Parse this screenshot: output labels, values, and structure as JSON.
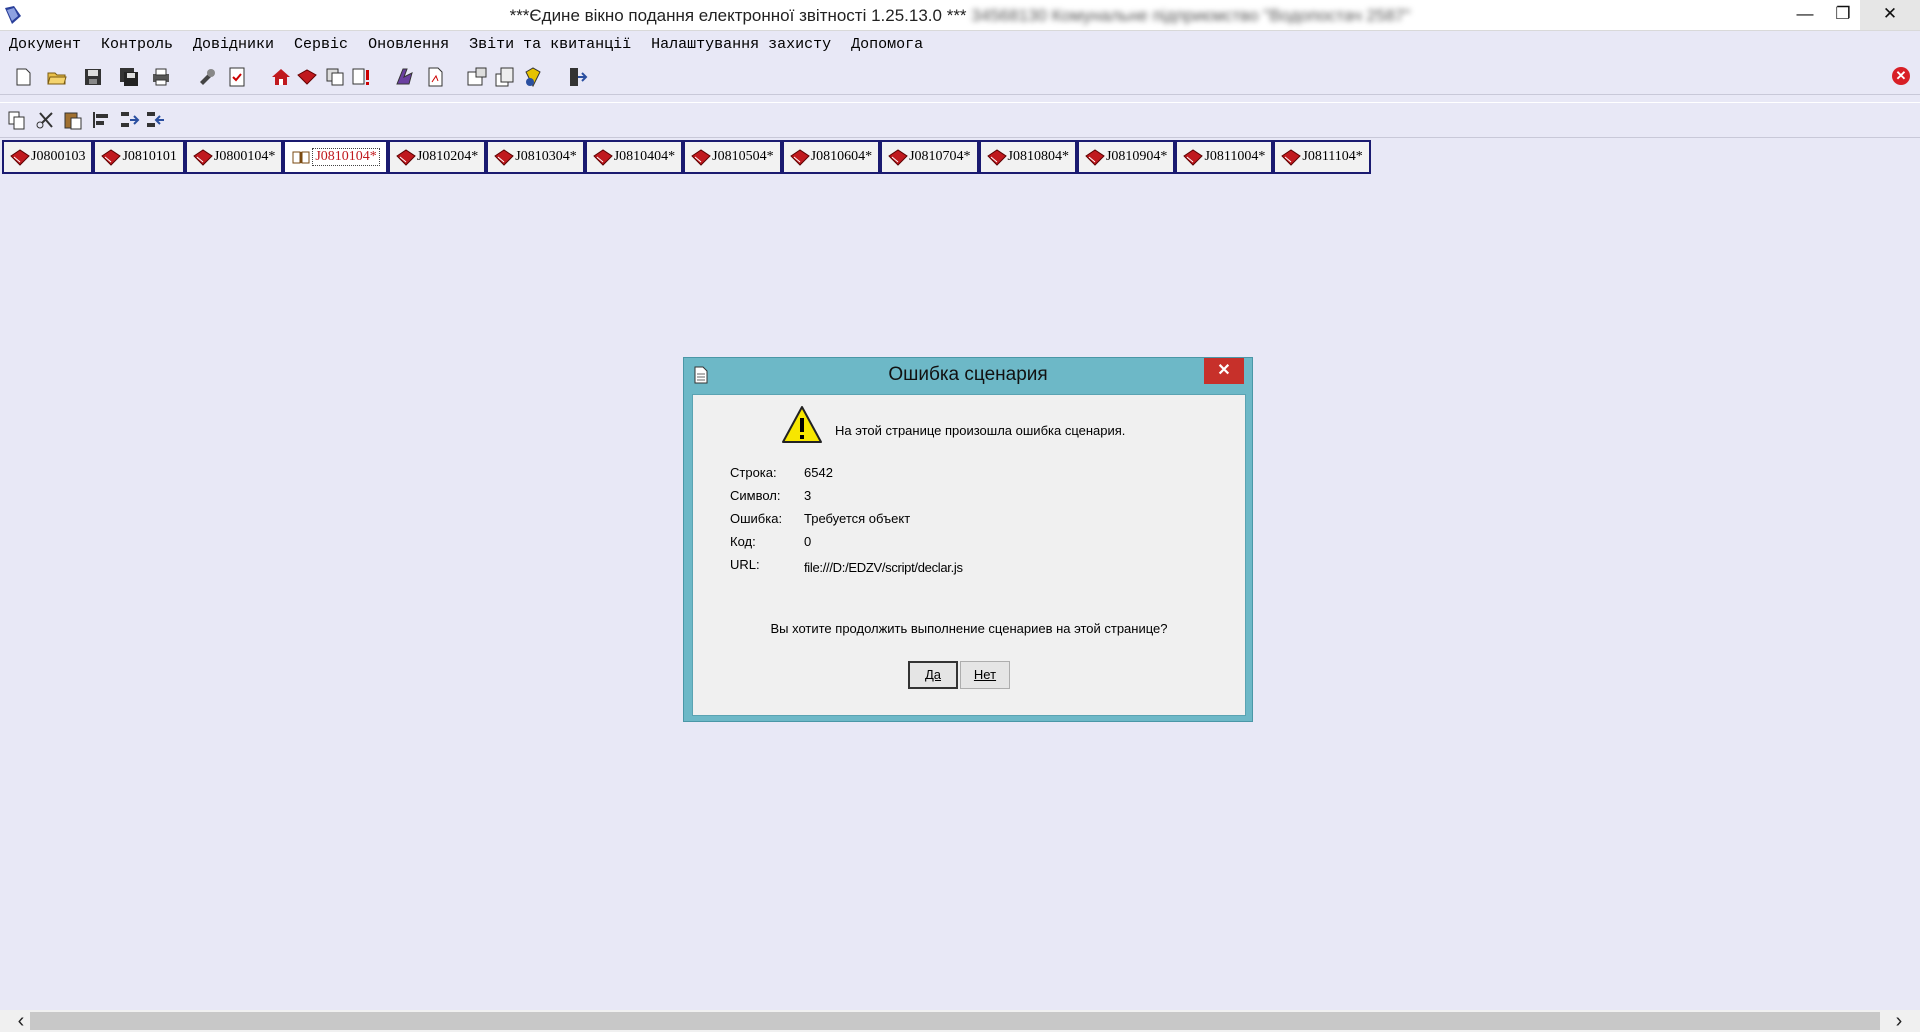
{
  "window": {
    "title": "***Єдине вікно подання електронної звітності 1.25.13.0 ***",
    "title_suffix": "34568130 Комунальне підприємство \"Водопостач 2587\"",
    "minimize": "—",
    "restore": "❐",
    "close": "✕"
  },
  "menu": [
    {
      "label": "Документ"
    },
    {
      "label": "Контроль"
    },
    {
      "label": "Довідники"
    },
    {
      "label": "Сервіс"
    },
    {
      "label": "Оновлення"
    },
    {
      "label": "Звіти та квитанції"
    },
    {
      "label": "Налаштування захисту"
    },
    {
      "label": "Допомога"
    }
  ],
  "toolbar_close": "✕",
  "tabs": [
    {
      "label": "J0800103",
      "active": false
    },
    {
      "label": "J0810101",
      "active": false
    },
    {
      "label": "J0800104*",
      "active": false
    },
    {
      "label": "J0810104*",
      "active": true
    },
    {
      "label": "J0810204*",
      "active": false
    },
    {
      "label": "J0810304*",
      "active": false
    },
    {
      "label": "J0810404*",
      "active": false
    },
    {
      "label": "J0810504*",
      "active": false
    },
    {
      "label": "J0810604*",
      "active": false
    },
    {
      "label": "J0810704*",
      "active": false
    },
    {
      "label": "J0810804*",
      "active": false
    },
    {
      "label": "J0810904*",
      "active": false
    },
    {
      "label": "J0811004*",
      "active": false
    },
    {
      "label": "J0811104*",
      "active": false
    }
  ],
  "dialog": {
    "title": "Ошибка сценария",
    "close": "✕",
    "message": "На этой странице произошла ошибка сценария.",
    "rows": [
      {
        "key": "Строка:",
        "value": "6542"
      },
      {
        "key": "Символ:",
        "value": "3"
      },
      {
        "key": "Ошибка:",
        "value": "Требуется объект"
      },
      {
        "key": "Код:",
        "value": "0"
      },
      {
        "key": "URL:",
        "value": "file:///D:/EDZV/script/declar.js"
      }
    ],
    "question": "Вы хотите продолжить выполнение сценариев на этой странице?",
    "yes": "Да",
    "no": "Нет"
  },
  "scroll": {
    "left": "‹",
    "right": "›"
  },
  "colors": {
    "background": "#e8e8f6",
    "dialog_frame": "#6db8c7",
    "dialog_close": "#c7302a",
    "tab_border": "#1a1a70",
    "active_tab_text": "#c0191e"
  },
  "icons": {
    "toolbar1": [
      "new-doc-icon",
      "open-folder-icon",
      "save-icon",
      "save-all-icon",
      "print-icon",
      "tools-icon",
      "check-doc-icon",
      "home-icon",
      "book-icon",
      "copy-docs-icon",
      "error-doc-icon",
      "sign-icon",
      "pdf-doc-icon",
      "settings-doc-icon",
      "export-doc-icon",
      "report-icon",
      "exit-icon"
    ],
    "toolbar2": [
      "copy-icon",
      "cut-icon",
      "paste-icon",
      "align-icon",
      "split-icon",
      "merge-icon"
    ]
  }
}
